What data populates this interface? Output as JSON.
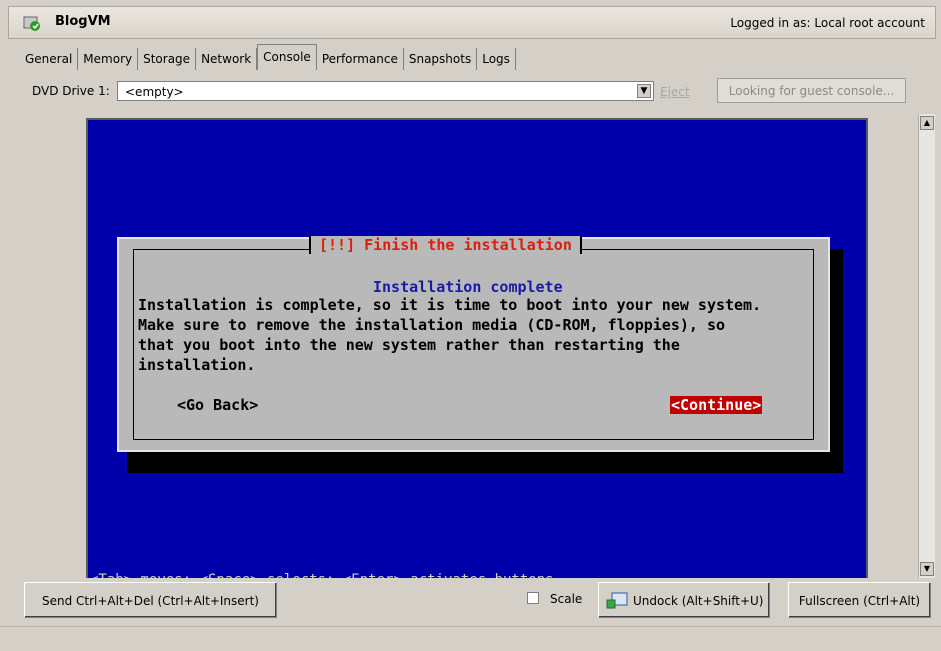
{
  "window": {
    "title": "BlogVM",
    "logged_in": "Logged in as:  Local root account"
  },
  "tabs": [
    "General",
    "Memory",
    "Storage",
    "Network",
    "Console",
    "Performance",
    "Snapshots",
    "Logs"
  ],
  "active_tab": "Console",
  "dvd": {
    "label": "DVD Drive 1:",
    "value": "<empty>",
    "eject_label": "Eject"
  },
  "looking_button": "Looking for guest console...",
  "installer": {
    "title": "[!!] Finish the installation",
    "subtitle": "Installation complete",
    "lines": [
      "Installation is complete, so it is time to boot into your new system.",
      "Make sure to remove the installation media (CD-ROM, floppies), so",
      "that you boot into the new system rather than restarting the",
      "installation."
    ],
    "go_back": "<Go Back>",
    "continue": "<Continue>",
    "help": "<Tab> moves; <Space> selects; <Enter> activates buttons"
  },
  "bottom": {
    "send_cad": "Send Ctrl+Alt+Del (Ctrl+Alt+Insert)",
    "scale": "Scale",
    "undock": "Undock (Alt+Shift+U)",
    "fullscreen": "Fullscreen (Ctrl+Alt)"
  },
  "colors": {
    "console_bg": "#0000aa",
    "dialog_bg": "#b9b9b9",
    "title_red": "#d91f0d",
    "continue_bg": "#c00000"
  }
}
